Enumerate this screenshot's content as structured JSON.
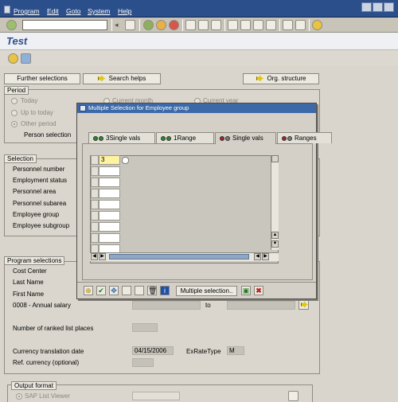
{
  "menu": {
    "items": [
      "Program",
      "Edit",
      "Goto",
      "System",
      "Help"
    ]
  },
  "toolbar": {
    "command_value": ""
  },
  "title": "Test",
  "buttons": {
    "further_selections": "Further selections",
    "search_helps": "Search helps",
    "org_structure": "Org. structure"
  },
  "period": {
    "title": "Period",
    "options": [
      "Today",
      "Up to today",
      "Other period"
    ],
    "options_right": [
      "Current month",
      "Current year"
    ],
    "person_selection": "Person selection"
  },
  "selection": {
    "title": "Selection",
    "items": [
      "Personnel number",
      "Employment status",
      "Personnel area",
      "Personnel subarea",
      "Employee group",
      "Employee subgroup"
    ]
  },
  "program_selections": {
    "title": "Program selections",
    "items": [
      "Cost Center",
      "Last Name",
      "First Name",
      "0008 - Annual salary"
    ],
    "to_label": "to",
    "ranked_label": "Number of ranked list places",
    "currency_date_label": "Currency translation date",
    "currency_date_value": "04/15/2006",
    "exrate_label": "ExRateType",
    "exrate_value": "M",
    "ref_currency_label": "Ref. currency (optional)"
  },
  "output_format": {
    "title": "Output format",
    "option": "SAP List Viewer"
  },
  "popup": {
    "title": "Multiple Selection for Employee group",
    "tabs": [
      {
        "label": "3Single vals",
        "colors": [
          "#2a8a2a",
          "#2a8a2a"
        ]
      },
      {
        "label": "1Range",
        "colors": [
          "#2a8a2a",
          "#2a8a2a"
        ]
      },
      {
        "label": "Single vals",
        "colors": [
          "#b02020",
          "#7a7a7a"
        ]
      },
      {
        "label": "Ranges",
        "colors": [
          "#b02020",
          "#7a7a7a"
        ]
      }
    ],
    "active_tab": 2,
    "entry_value": "3",
    "multiple_selection_label": "Multiple selection.."
  },
  "colors": {
    "sap_blue": "#2b4f8a",
    "popup_title": "#3c6aa8",
    "active_cell": "#fff2a0"
  }
}
